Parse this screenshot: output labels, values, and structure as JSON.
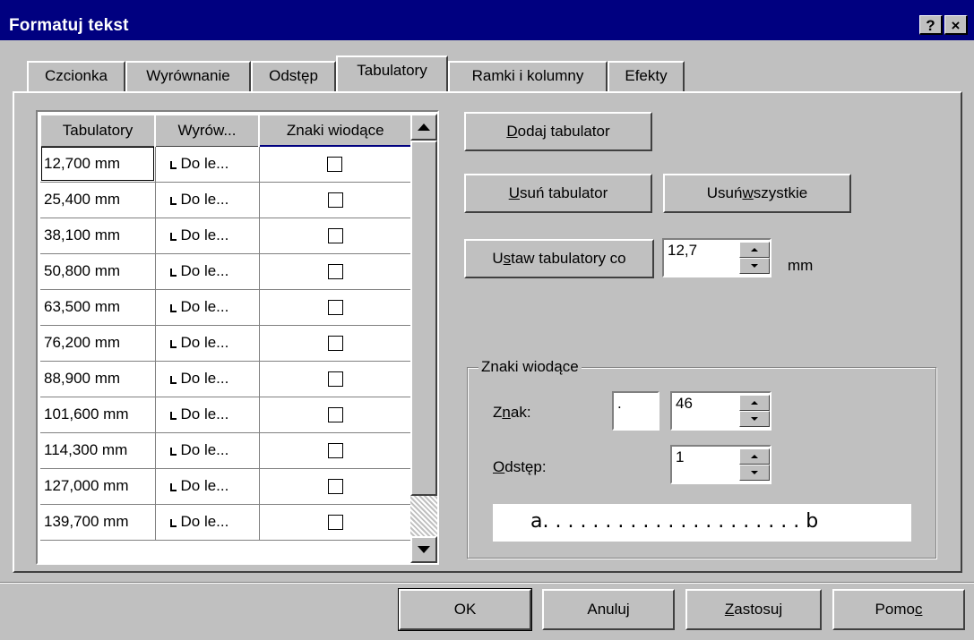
{
  "window": {
    "title": "Formatuj tekst",
    "help_button": "?",
    "close_button": "×"
  },
  "tabs": [
    {
      "label": "Czcionka"
    },
    {
      "label": "Wyrównanie"
    },
    {
      "label": "Odstęp"
    },
    {
      "label": "Tabulatory"
    },
    {
      "label": "Ramki i kolumny"
    },
    {
      "label": "Efekty"
    }
  ],
  "table": {
    "headers": [
      "Tabulatory",
      "Wyrów...",
      "Znaki wiodące"
    ],
    "rows": [
      {
        "position": "12,700 mm",
        "alignment": "Do le..."
      },
      {
        "position": "25,400 mm",
        "alignment": "Do le..."
      },
      {
        "position": "38,100 mm",
        "alignment": "Do le..."
      },
      {
        "position": "50,800 mm",
        "alignment": "Do le..."
      },
      {
        "position": "63,500 mm",
        "alignment": "Do le..."
      },
      {
        "position": "76,200 mm",
        "alignment": "Do le..."
      },
      {
        "position": "88,900 mm",
        "alignment": "Do le..."
      },
      {
        "position": "101,600 mm",
        "alignment": "Do le..."
      },
      {
        "position": "114,300 mm",
        "alignment": "Do le..."
      },
      {
        "position": "127,000 mm",
        "alignment": "Do le..."
      },
      {
        "position": "139,700 mm",
        "alignment": "Do le..."
      }
    ]
  },
  "buttons": {
    "add_tab": {
      "pre": "",
      "key": "D",
      "post": "odaj tabulator"
    },
    "remove_tab": {
      "pre": "",
      "key": "U",
      "post": "suń tabulator"
    },
    "remove_all": {
      "pre": "Usuń ",
      "key": "w",
      "post": "szystkie"
    },
    "set_every": {
      "pre": "U",
      "key": "s",
      "post": "taw tabulatory co"
    }
  },
  "interval": {
    "value": "12,7",
    "unit": "mm"
  },
  "leaders": {
    "group_label": "Znaki wiodące",
    "char_label": {
      "pre": "Z",
      "key": "n",
      "post": "ak:"
    },
    "char_value": ".",
    "char_code": "46",
    "spacing_label": {
      "pre": "",
      "key": "O",
      "post": "dstęp:"
    },
    "spacing_value": "1",
    "preview": "a. . . . . . . . . . . . . . . . . . . . . b"
  },
  "footer": {
    "ok": "OK",
    "cancel": "Anuluj",
    "apply": {
      "pre": "",
      "key": "Z",
      "post": "astosuj"
    },
    "help": {
      "pre": "Pomo",
      "key": "c",
      "post": ""
    }
  }
}
